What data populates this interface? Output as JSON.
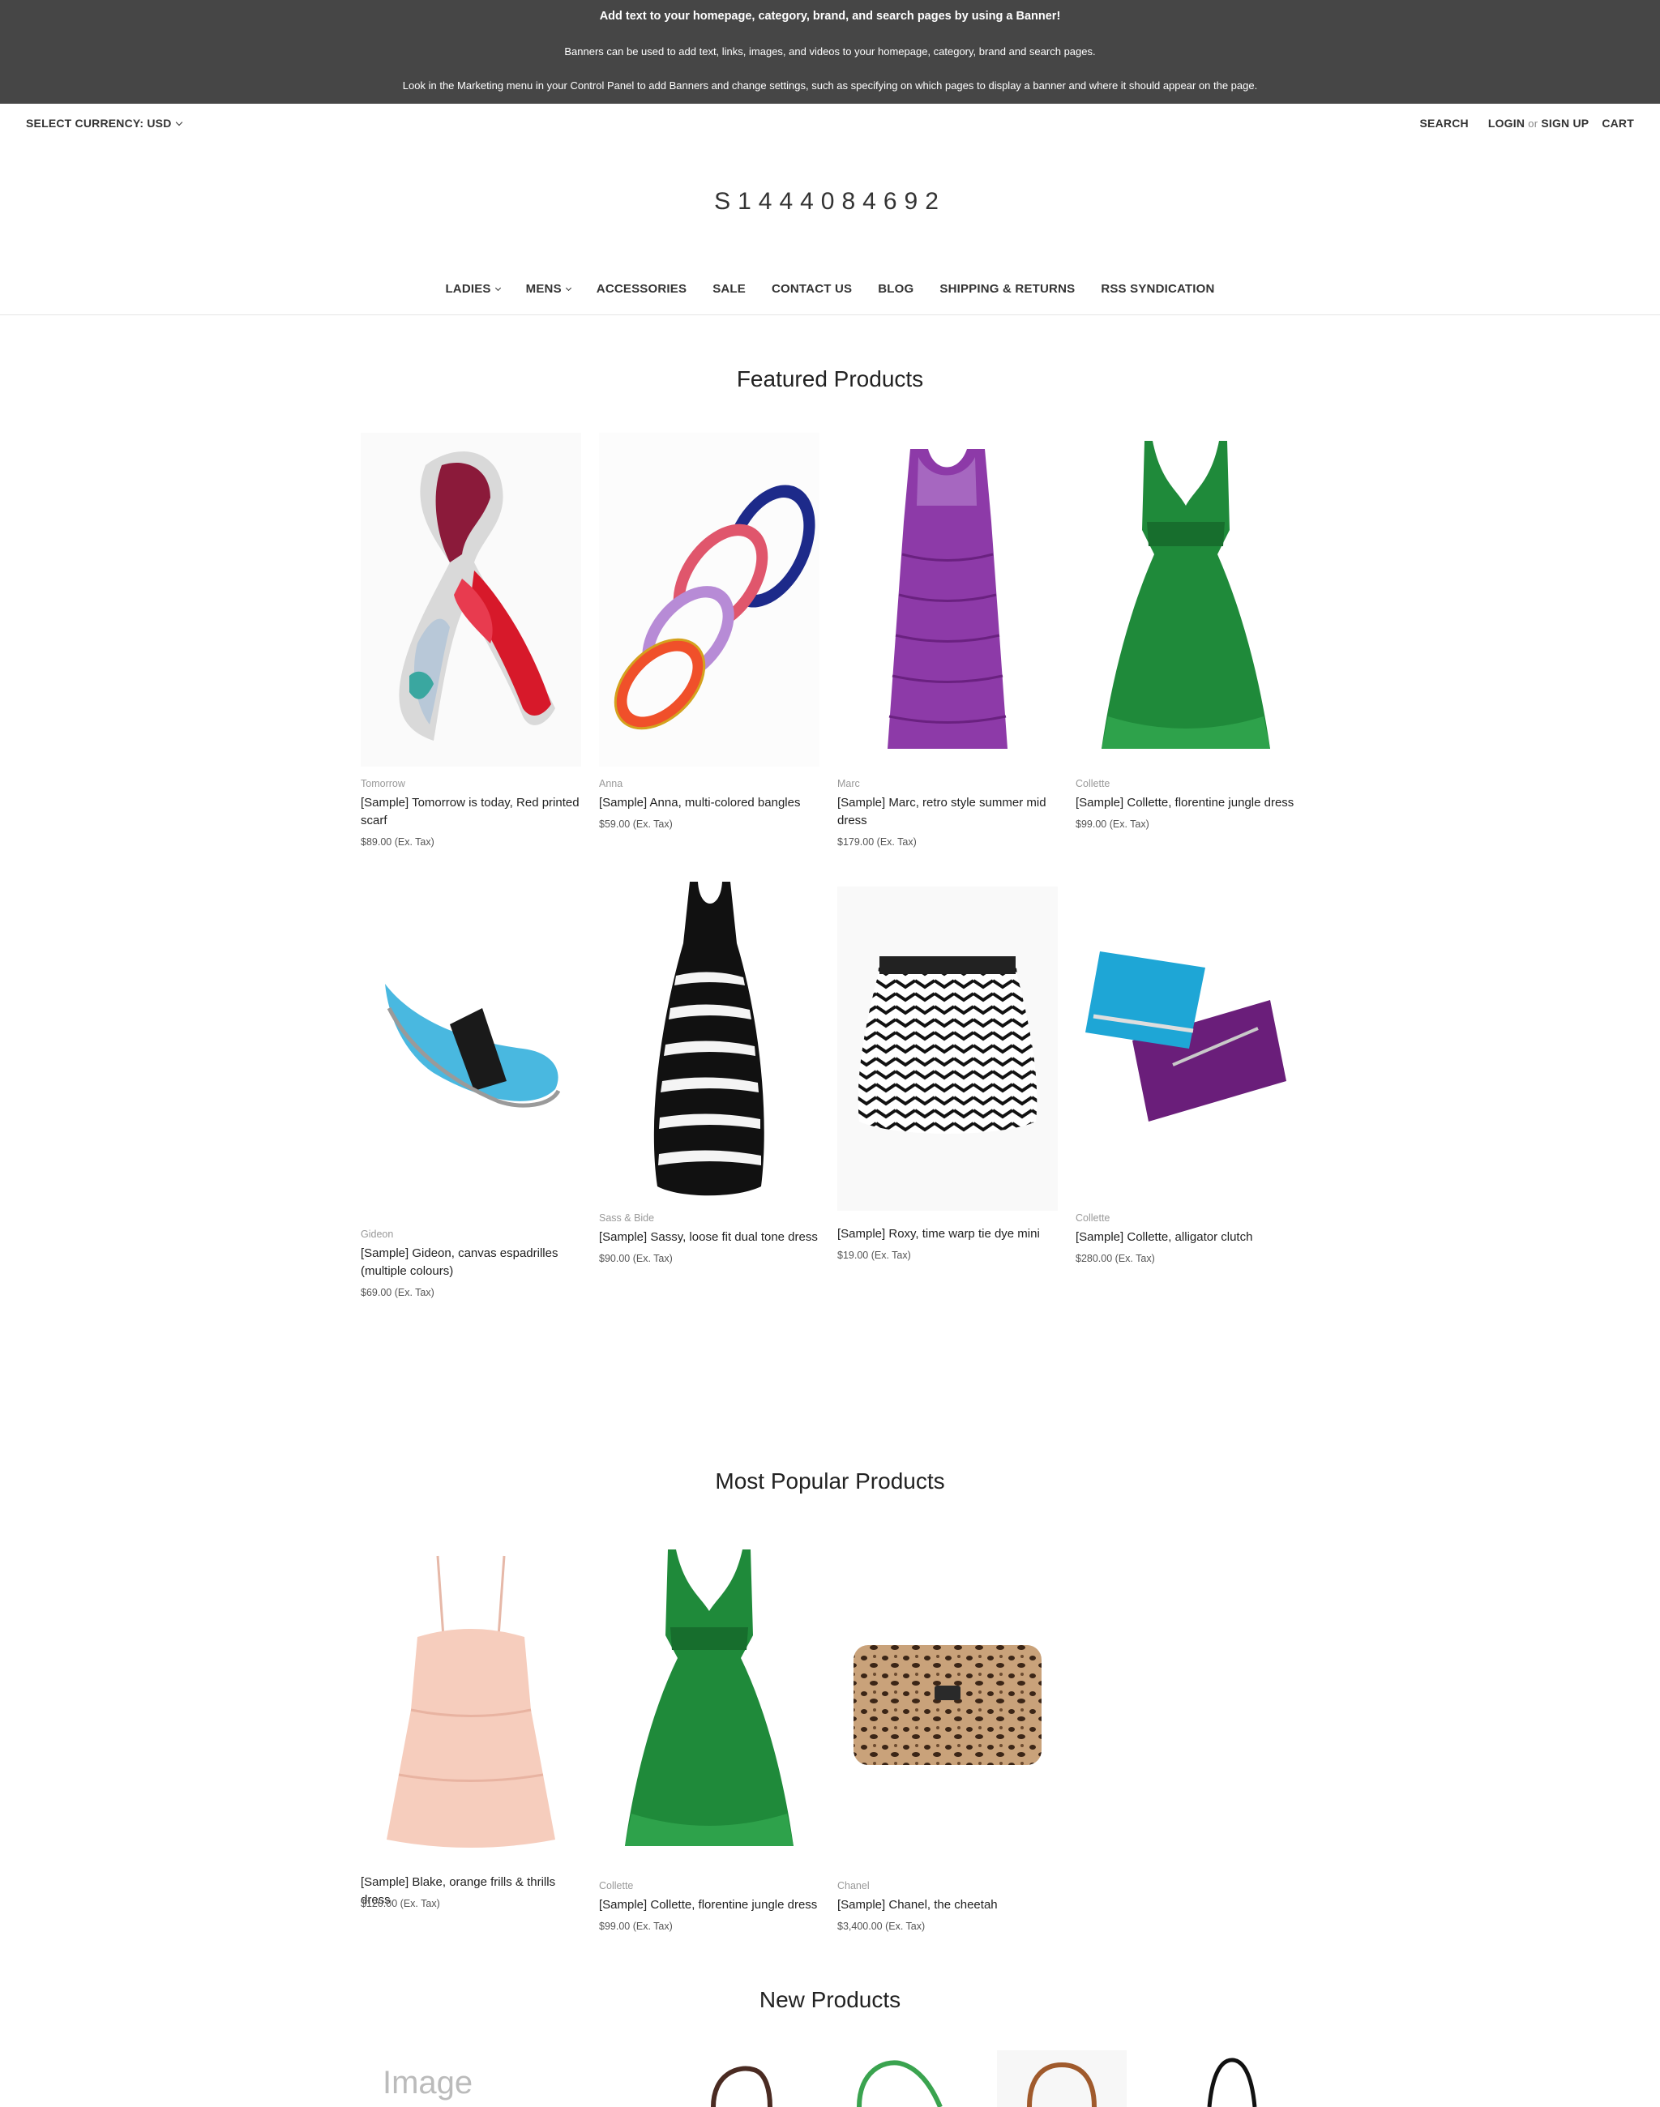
{
  "banner": {
    "line1": "Add text to your homepage, category, brand, and search pages by using a Banner!",
    "line2": "Banners can be used to add text, links, images, and videos to your homepage, category, brand and search pages.",
    "line3": "Look in the Marketing menu in your Control Panel to add Banners and change settings, such as specifying on which pages to display a banner and where it should appear on the page."
  },
  "topbar": {
    "currency": "SELECT CURRENCY: USD",
    "search": "SEARCH",
    "login": "LOGIN",
    "or": "or",
    "signup": "SIGN UP",
    "cart": "CART"
  },
  "logo": "S1444084692",
  "nav": {
    "ladies": "LADIES",
    "mens": "MENS",
    "accessories": "ACCESSORIES",
    "sale": "SALE",
    "contact": "CONTACT US",
    "blog": "BLOG",
    "shipping": "SHIPPING & RETURNS",
    "rss": "RSS SYNDICATION"
  },
  "featured": {
    "heading": "Featured Products",
    "products": [
      {
        "brand": "Tomorrow",
        "title": "[Sample] Tomorrow is today, Red printed scarf",
        "price": "$89.00 (Ex. Tax)",
        "icon": "scarf-image"
      },
      {
        "brand": "Anna",
        "title": "[Sample] Anna, multi-colored bangles",
        "price": "$59.00 (Ex. Tax)",
        "icon": "bangles-image"
      },
      {
        "brand": "Marc",
        "title": "[Sample] Marc, retro style summer mid dress",
        "price": "$179.00 (Ex. Tax)",
        "icon": "purple-dress-image"
      },
      {
        "brand": "Collette",
        "title": "[Sample] Collette, florentine jungle dress",
        "price": "$99.00 (Ex. Tax)",
        "icon": "green-dress-image"
      },
      {
        "brand": "Gideon",
        "title": "[Sample] Gideon, canvas espadrilles (multiple colours)",
        "price": "$69.00 (Ex. Tax)",
        "icon": "espadrille-image"
      },
      {
        "brand": "Sass & Bide",
        "title": "[Sample] Sassy, loose fit dual tone dress",
        "price": "$90.00 (Ex. Tax)",
        "icon": "tie-dye-dress-image"
      },
      {
        "brand": "",
        "title": "[Sample] Roxy, time warp tie dye mini",
        "price": "$19.00 (Ex. Tax)",
        "icon": "chevron-skirt-image"
      },
      {
        "brand": "Collette",
        "title": "[Sample] Collette, alligator clutch",
        "price": "$280.00 (Ex. Tax)",
        "icon": "clutch-image"
      }
    ]
  },
  "popular": {
    "heading": "Most Popular Products",
    "products": [
      {
        "brand": "",
        "title": "[Sample] Blake, orange frills & thrills dress",
        "price": "$120.00 (Ex. Tax)",
        "icon": "peach-dress-image"
      },
      {
        "brand": "Collette",
        "title": "[Sample] Collette, florentine jungle dress",
        "price": "$99.00 (Ex. Tax)",
        "icon": "green-dress-image"
      },
      {
        "brand": "Chanel",
        "title": "[Sample] Chanel, the cheetah",
        "price": "$3,400.00 (Ex. Tax)",
        "icon": "leopard-clutch-image"
      }
    ]
  },
  "new_products": {
    "heading": "New Products",
    "placeholder": "Image"
  },
  "colors": {
    "banner_bg": "#464646",
    "text": "#222222",
    "muted": "#999999"
  }
}
